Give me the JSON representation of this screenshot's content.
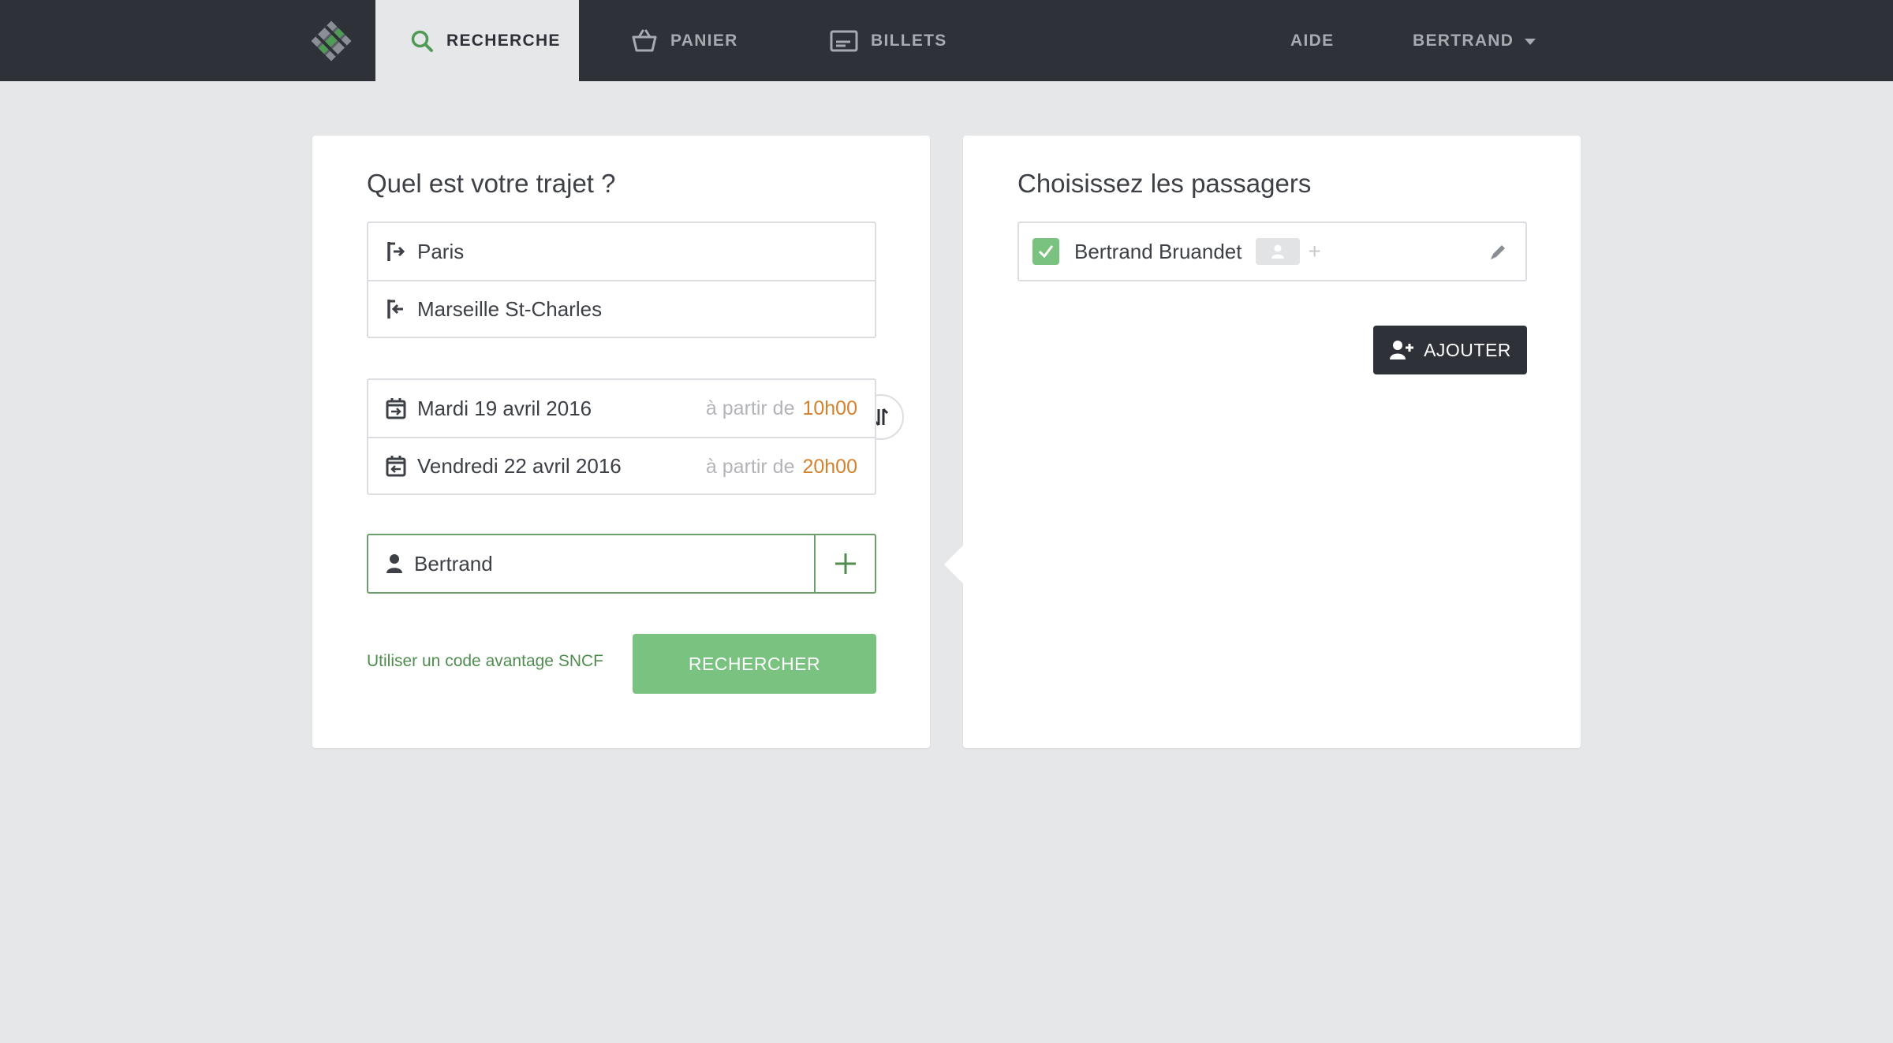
{
  "nav": {
    "tabs": [
      {
        "label": "RECHERCHE",
        "icon": "search-icon",
        "active": true
      },
      {
        "label": "PANIER",
        "icon": "basket-icon",
        "active": false
      },
      {
        "label": "BILLETS",
        "icon": "ticket-icon",
        "active": false
      }
    ],
    "help_label": "AIDE",
    "user_label": "BERTRAND"
  },
  "trip": {
    "title": "Quel est votre trajet ?",
    "origin": "Paris",
    "destination": "Marseille St-Charles",
    "outbound_date": "Mardi 19 avril 2016",
    "return_date": "Vendredi 22 avril 2016",
    "from_label": "à partir de",
    "outbound_time": "10h00",
    "return_time": "20h00",
    "passenger": "Bertrand",
    "promo_link": "Utiliser un code avantage SNCF",
    "search_button": "RECHERCHER"
  },
  "passengers": {
    "title": "Choisissez les passagers",
    "items": [
      {
        "name": "Bertrand Bruandet",
        "checked": true
      }
    ],
    "add_button": "AJOUTER"
  },
  "colors": {
    "nav_bg": "#2e3138",
    "page_bg": "#e6e7e9",
    "accent_green": "#79c27f",
    "time_orange": "#d3812b"
  }
}
